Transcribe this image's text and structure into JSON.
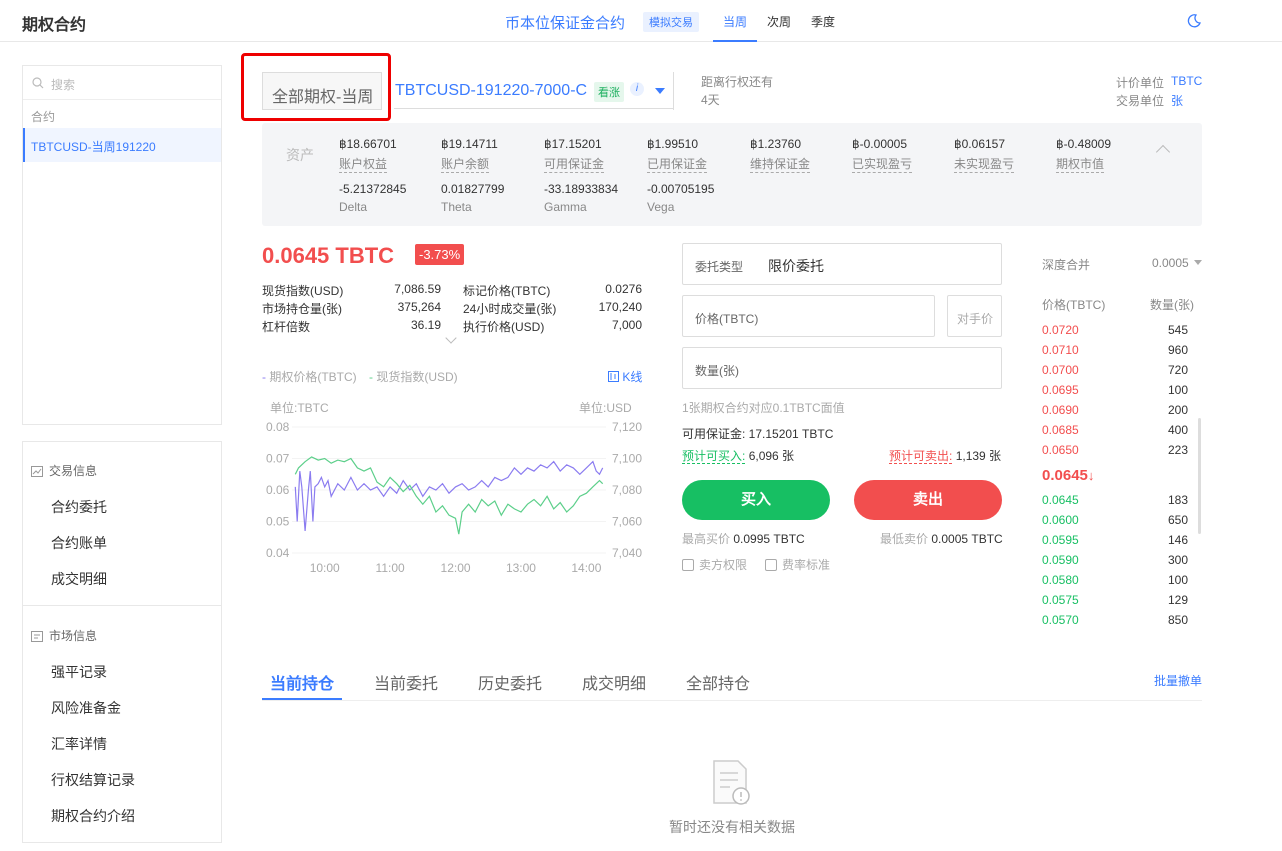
{
  "header": {
    "app_title": "期权合约",
    "center_title": "币本位保证金合约",
    "sim_badge": "模拟交易",
    "tabs": [
      {
        "label": "当周",
        "active": true
      },
      {
        "label": "次周",
        "active": false
      },
      {
        "label": "季度",
        "active": false
      }
    ],
    "theme_icon": "moon-icon"
  },
  "sidebar": {
    "search_placeholder": "搜索",
    "contract_section_label": "合约",
    "active_contract": "TBTCUSD-当周191220",
    "trade_info": {
      "title": "交易信息",
      "items": [
        "合约委托",
        "合约账单",
        "成交明细"
      ]
    },
    "market_info": {
      "title": "市场信息",
      "items": [
        "强平记录",
        "风险准备金",
        "汇率详情",
        "行权结算记录",
        "期权合约介绍"
      ]
    }
  },
  "contract": {
    "selector_label": "全部期权-当周",
    "name": "TBTCUSD-191220-7000-C",
    "type_badge": "看涨",
    "info_icon": "i",
    "expire_label": "距离行权还有",
    "expire_value": "4天",
    "price_unit_label": "计价单位",
    "price_unit_value": "TBTC",
    "trade_unit_label": "交易单位",
    "trade_unit_value": "张"
  },
  "assets": {
    "label": "资产",
    "row1": [
      {
        "value": "฿18.66701",
        "key": "账户权益"
      },
      {
        "value": "฿19.14711",
        "key": "账户余额"
      },
      {
        "value": "฿17.15201",
        "key": "可用保证金"
      },
      {
        "value": "฿1.99510",
        "key": "已用保证金"
      },
      {
        "value": "฿1.23760",
        "key": "维持保证金"
      },
      {
        "value": "฿-0.00005",
        "key": "已实现盈亏"
      },
      {
        "value": "฿0.06157",
        "key": "未实现盈亏"
      },
      {
        "value": "฿-0.48009",
        "key": "期权市值"
      }
    ],
    "row2": [
      {
        "value": "-5.21372845",
        "key": "Delta"
      },
      {
        "value": "0.01827799",
        "key": "Theta"
      },
      {
        "value": "-33.18933834",
        "key": "Gamma"
      },
      {
        "value": "-0.00705195",
        "key": "Vega"
      }
    ]
  },
  "ticker": {
    "price": "0.0645 TBTC",
    "change_pct": "-3.73%",
    "stats_left": [
      {
        "label": "现货指数(USD)",
        "value": "7,086.59"
      },
      {
        "label": "市场持仓量(张)",
        "value": "375,264"
      },
      {
        "label": "杠杆倍数",
        "value": "36.19"
      }
    ],
    "stats_right": [
      {
        "label": "标记价格(TBTC)",
        "value": "0.0276"
      },
      {
        "label": "24小时成交量(张)",
        "value": "170,240"
      },
      {
        "label": "执行价格(USD)",
        "value": "7,000"
      }
    ]
  },
  "chart_labels": {
    "legend_option": "期权价格(TBTC)",
    "legend_spot": "现货指数(USD)",
    "kline_link": "K线",
    "unit_left": "单位:TBTC",
    "unit_right": "单位:USD"
  },
  "chart_data": {
    "type": "line",
    "x_ticks": [
      "10:00",
      "11:00",
      "12:00",
      "13:00",
      "14:00"
    ],
    "y_left_ticks": [
      "0.08",
      "0.07",
      "0.06",
      "0.05",
      "0.04"
    ],
    "y_right_ticks": [
      "7,120",
      "7,100",
      "7,080",
      "7,060",
      "7,040"
    ],
    "ylim_left": [
      0.04,
      0.08
    ],
    "ylim_right": [
      7040,
      7120
    ],
    "x_range_hours": [
      9.5,
      14.3
    ],
    "series": [
      {
        "name": "期权价格(TBTC)",
        "color": "#8b7cf0",
        "axis": "left",
        "x": [
          9.55,
          9.58,
          9.62,
          9.65,
          9.7,
          9.75,
          9.78,
          9.82,
          9.85,
          9.9,
          9.95,
          10.0,
          10.05,
          10.1,
          10.2,
          10.3,
          10.4,
          10.5,
          10.6,
          10.7,
          10.8,
          10.9,
          11.0,
          11.1,
          11.2,
          11.3,
          11.4,
          11.5,
          11.6,
          11.7,
          11.8,
          11.9,
          12.0,
          12.1,
          12.2,
          12.3,
          12.4,
          12.5,
          12.6,
          12.7,
          12.8,
          12.9,
          13.0,
          13.1,
          13.2,
          13.3,
          13.4,
          13.5,
          13.6,
          13.7,
          13.8,
          13.9,
          14.0,
          14.1,
          14.15,
          14.2,
          14.25
        ],
        "y": [
          0.061,
          0.05,
          0.066,
          0.061,
          0.047,
          0.06,
          0.066,
          0.05,
          0.061,
          0.062,
          0.064,
          0.061,
          0.063,
          0.058,
          0.062,
          0.06,
          0.064,
          0.06,
          0.062,
          0.06,
          0.061,
          0.058,
          0.061,
          0.059,
          0.063,
          0.06,
          0.062,
          0.058,
          0.061,
          0.06,
          0.062,
          0.059,
          0.061,
          0.062,
          0.06,
          0.061,
          0.063,
          0.061,
          0.064,
          0.063,
          0.064,
          0.067,
          0.065,
          0.067,
          0.066,
          0.068,
          0.067,
          0.069,
          0.066,
          0.068,
          0.067,
          0.065,
          0.067,
          0.069,
          0.066,
          0.065,
          0.067
        ]
      },
      {
        "name": "现货指数(USD)",
        "color": "#5ccf8a",
        "axis": "right",
        "x": [
          9.55,
          9.6,
          9.7,
          9.8,
          9.9,
          10.0,
          10.1,
          10.2,
          10.3,
          10.4,
          10.5,
          10.6,
          10.7,
          10.8,
          10.9,
          11.0,
          11.1,
          11.2,
          11.3,
          11.4,
          11.5,
          11.6,
          11.7,
          11.8,
          11.9,
          12.0,
          12.05,
          12.1,
          12.2,
          12.3,
          12.4,
          12.5,
          12.6,
          12.7,
          12.8,
          12.9,
          13.0,
          13.1,
          13.2,
          13.3,
          13.4,
          13.5,
          13.6,
          13.7,
          13.8,
          13.9,
          14.0,
          14.1,
          14.2,
          14.25
        ],
        "y": [
          7090,
          7094,
          7098,
          7101,
          7099,
          7100,
          7097,
          7099,
          7098,
          7100,
          7094,
          7092,
          7094,
          7085,
          7082,
          7088,
          7084,
          7079,
          7083,
          7076,
          7071,
          7076,
          7066,
          7070,
          7064,
          7062,
          7052,
          7066,
          7071,
          7066,
          7074,
          7070,
          7073,
          7064,
          7071,
          7068,
          7066,
          7071,
          7074,
          7070,
          7076,
          7068,
          7072,
          7066,
          7070,
          7076,
          7078,
          7082,
          7086,
          7084
        ]
      }
    ]
  },
  "order_form": {
    "type_label": "委托类型",
    "type_value": "限价委托",
    "price_label": "价格(TBTC)",
    "counter_price": "对手价",
    "qty_label": "数量(张)",
    "face_value_hint": "1张期权合约对应0.1TBTC面值",
    "available_margin": "可用保证金: 17.15201 TBTC",
    "est_buy_label": "预计可买入:",
    "est_buy_value": "6,096 张",
    "est_sell_label": "预计可卖出:",
    "est_sell_value": "1,139 张",
    "buy_button": "买入",
    "sell_button": "卖出",
    "max_buy_label": "最高买价",
    "max_buy_value": "0.0995 TBTC",
    "min_sell_label": "最低卖价",
    "min_sell_value": "0.0005 TBTC",
    "seller_rights": "卖方权限",
    "fee_standard": "费率标准"
  },
  "order_book": {
    "depth_label": "深度合并",
    "depth_value": "0.0005",
    "col_price": "价格(TBTC)",
    "col_qty": "数量(张)",
    "asks": [
      {
        "price": "0.0720",
        "qty": "545"
      },
      {
        "price": "0.0710",
        "qty": "960"
      },
      {
        "price": "0.0700",
        "qty": "720"
      },
      {
        "price": "0.0695",
        "qty": "100"
      },
      {
        "price": "0.0690",
        "qty": "200"
      },
      {
        "price": "0.0685",
        "qty": "400"
      },
      {
        "price": "0.0650",
        "qty": "223"
      }
    ],
    "last_price": "0.0645",
    "last_arrow": "↓",
    "bids": [
      {
        "price": "0.0645",
        "qty": "183"
      },
      {
        "price": "0.0600",
        "qty": "650"
      },
      {
        "price": "0.0595",
        "qty": "146"
      },
      {
        "price": "0.0590",
        "qty": "300"
      },
      {
        "price": "0.0580",
        "qty": "100"
      },
      {
        "price": "0.0575",
        "qty": "129"
      },
      {
        "price": "0.0570",
        "qty": "850"
      }
    ]
  },
  "bottom": {
    "tabs": [
      "当前持仓",
      "当前委托",
      "历史委托",
      "成交明细",
      "全部持仓"
    ],
    "batch_cancel": "批量撤单",
    "empty_text": "暂时还没有相关数据"
  }
}
